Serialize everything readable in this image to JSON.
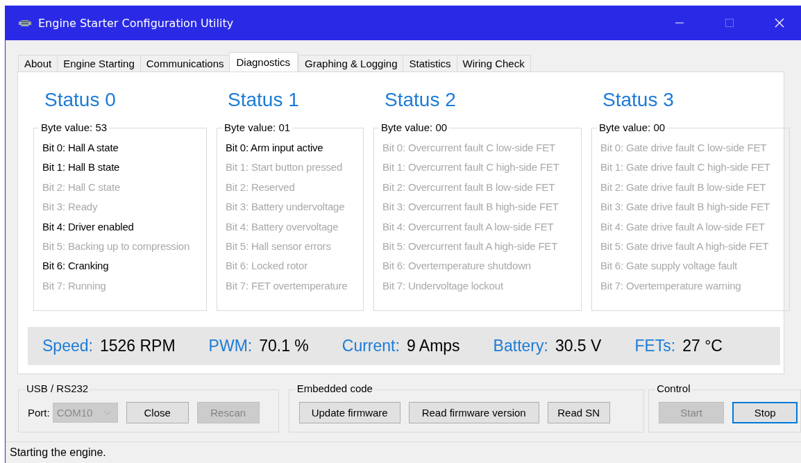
{
  "window": {
    "title": "Engine Starter Configuration Utility"
  },
  "tabs": [
    {
      "label": "About",
      "selected": false
    },
    {
      "label": "Engine Starting",
      "selected": false
    },
    {
      "label": "Communications",
      "selected": false
    },
    {
      "label": "Diagnostics",
      "selected": true
    },
    {
      "label": "Graphing & Logging",
      "selected": false
    },
    {
      "label": "Statistics",
      "selected": false
    },
    {
      "label": "Wiring Check",
      "selected": false
    }
  ],
  "statuses": [
    {
      "title": "Status 0",
      "byte_value": "Byte value: 53",
      "bits": [
        {
          "label": "Bit 0: Hall A state",
          "active": true
        },
        {
          "label": "Bit 1: Hall B state",
          "active": true
        },
        {
          "label": "Bit 2: Hall C state",
          "active": false
        },
        {
          "label": "Bit 3: Ready",
          "active": false
        },
        {
          "label": "Bit 4: Driver enabled",
          "active": true
        },
        {
          "label": "Bit 5: Backing up to compression",
          "active": false
        },
        {
          "label": "Bit 6: Cranking",
          "active": true
        },
        {
          "label": "Bit 7: Running",
          "active": false
        }
      ]
    },
    {
      "title": "Status 1",
      "byte_value": "Byte value: 01",
      "bits": [
        {
          "label": "Bit 0: Arm input active",
          "active": true
        },
        {
          "label": "Bit 1: Start button pressed",
          "active": false
        },
        {
          "label": "Bit 2: Reserved",
          "active": false
        },
        {
          "label": "Bit 3: Battery undervoltage",
          "active": false
        },
        {
          "label": "Bit 4: Battery overvoltage",
          "active": false
        },
        {
          "label": "Bit 5: Hall sensor errors",
          "active": false
        },
        {
          "label": "Bit 6: Locked rotor",
          "active": false
        },
        {
          "label": "Bit 7: FET overtemperature",
          "active": false
        }
      ]
    },
    {
      "title": "Status 2",
      "byte_value": "Byte value: 00",
      "bits": [
        {
          "label": "Bit 0: Overcurrent fault C low-side FET",
          "active": false
        },
        {
          "label": "Bit 1: Overcurrent fault C high-side FET",
          "active": false
        },
        {
          "label": "Bit 2: Overcurrent fault B low-side FET",
          "active": false
        },
        {
          "label": "Bit 3: Overcurrent fault B high-side FET",
          "active": false
        },
        {
          "label": "Bit 4: Overcurrent fault A low-side FET",
          "active": false
        },
        {
          "label": "Bit 5: Overcurrent fault A high-side FET",
          "active": false
        },
        {
          "label": "Bit 6: Overtemperature shutdown",
          "active": false
        },
        {
          "label": "Bit 7: Undervoltage lockout",
          "active": false
        }
      ]
    },
    {
      "title": "Status 3",
      "byte_value": "Byte value: 00",
      "bits": [
        {
          "label": "Bit 0: Gate drive fault C low-side FET",
          "active": false
        },
        {
          "label": "Bit 1: Gate drive fault C high-side FET",
          "active": false
        },
        {
          "label": "Bit 2: Gate drive fault B low-side FET",
          "active": false
        },
        {
          "label": "Bit 3: Gate drive fault B high-side FET",
          "active": false
        },
        {
          "label": "Bit 4: Gate drive fault A low-side FET",
          "active": false
        },
        {
          "label": "Bit 5: Gate drive fault A high-side FET",
          "active": false
        },
        {
          "label": "Bit 6: Gate supply voltage fault",
          "active": false
        },
        {
          "label": "Bit 7: Overtemperature warning",
          "active": false
        }
      ]
    }
  ],
  "readings": [
    {
      "label": "Speed:",
      "value": "1526 RPM"
    },
    {
      "label": "PWM:",
      "value": "70.1 %"
    },
    {
      "label": "Current:",
      "value": "9 Amps"
    },
    {
      "label": "Battery:",
      "value": "30.5 V"
    },
    {
      "label": "FETs:",
      "value": "27 °C"
    }
  ],
  "usb": {
    "title": "USB / RS232",
    "port_label": "Port:",
    "port": {
      "value": "COM10",
      "disabled": true
    },
    "buttons": [
      {
        "label": "Close",
        "disabled": false,
        "focused": false
      },
      {
        "label": "Rescan",
        "disabled": true,
        "focused": false
      }
    ]
  },
  "embedded": {
    "title": "Embedded code",
    "buttons": [
      {
        "label": "Update firmware",
        "disabled": false,
        "focused": false
      },
      {
        "label": "Read firmware version",
        "disabled": false,
        "focused": false
      },
      {
        "label": "Read SN",
        "disabled": false,
        "focused": false
      }
    ]
  },
  "control": {
    "title": "Control",
    "buttons": [
      {
        "label": "Start",
        "disabled": true,
        "focused": false
      },
      {
        "label": "Stop",
        "disabled": false,
        "focused": true
      }
    ]
  },
  "status_bar": "Starting the engine."
}
